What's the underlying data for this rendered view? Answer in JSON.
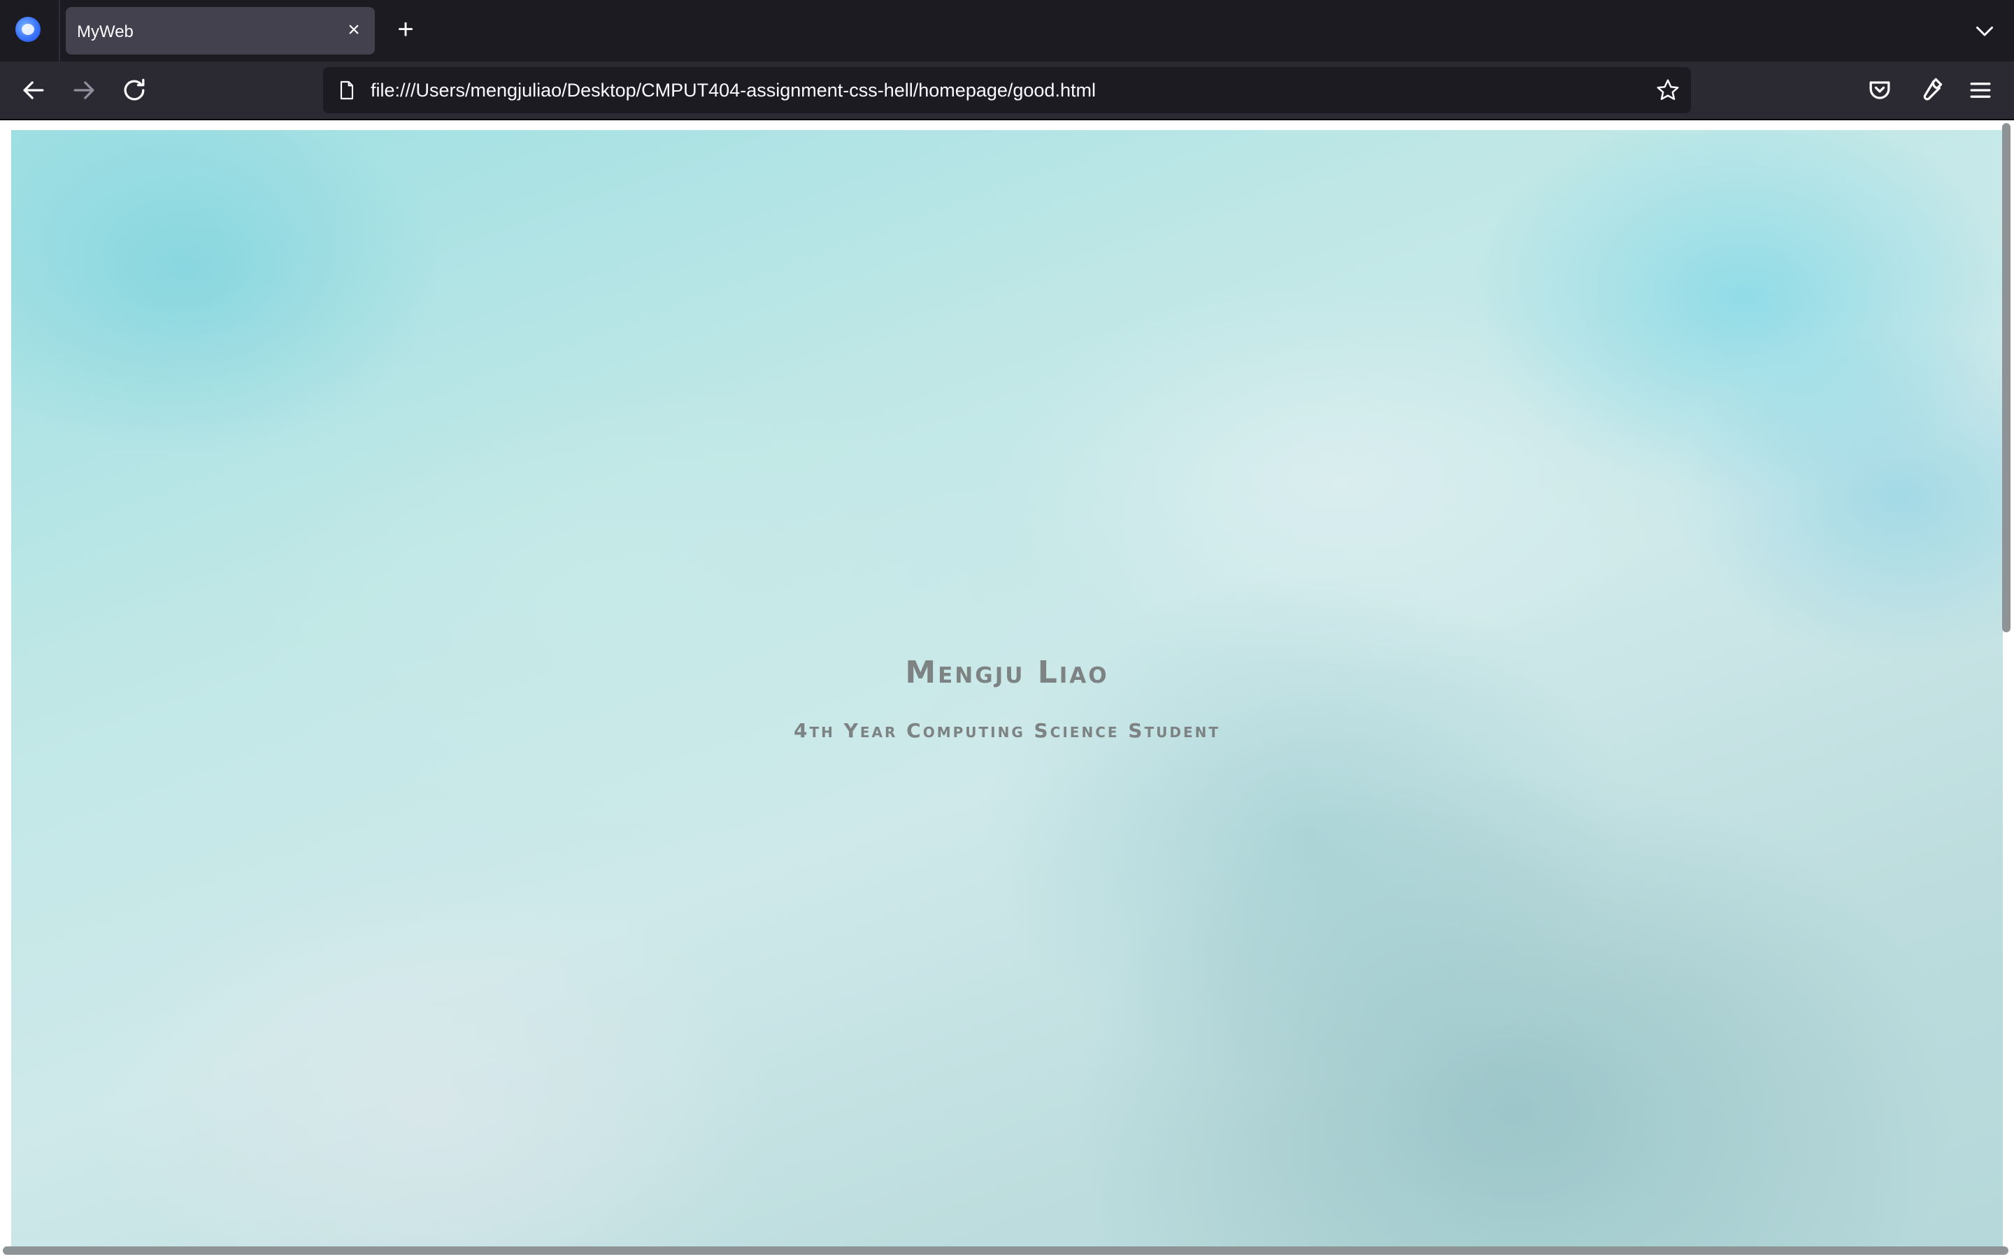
{
  "browser": {
    "tab": {
      "title": "MyWeb",
      "close_icon": "close-icon"
    },
    "new_tab_icon": "plus-icon",
    "tab_list_icon": "chevron-down-icon",
    "url": "file:///Users/mengjuliao/Desktop/CMPUT404-assignment-css-hell/homepage/good.html",
    "toolbar_icons": [
      "back-icon",
      "forward-icon",
      "reload-icon",
      "page-icon",
      "star-icon",
      "pocket-icon",
      "wrench-icon",
      "menu-icon"
    ]
  },
  "page": {
    "name": "Mengju Liao",
    "subtitle": "4th Year Computing Science Student"
  },
  "colors": {
    "chrome_dark": "#1c1b22",
    "chrome_nav": "#2b2a33",
    "tab_active": "#42414d",
    "hero_text": "#7d8283",
    "hero_accent": "#9edfe3"
  }
}
